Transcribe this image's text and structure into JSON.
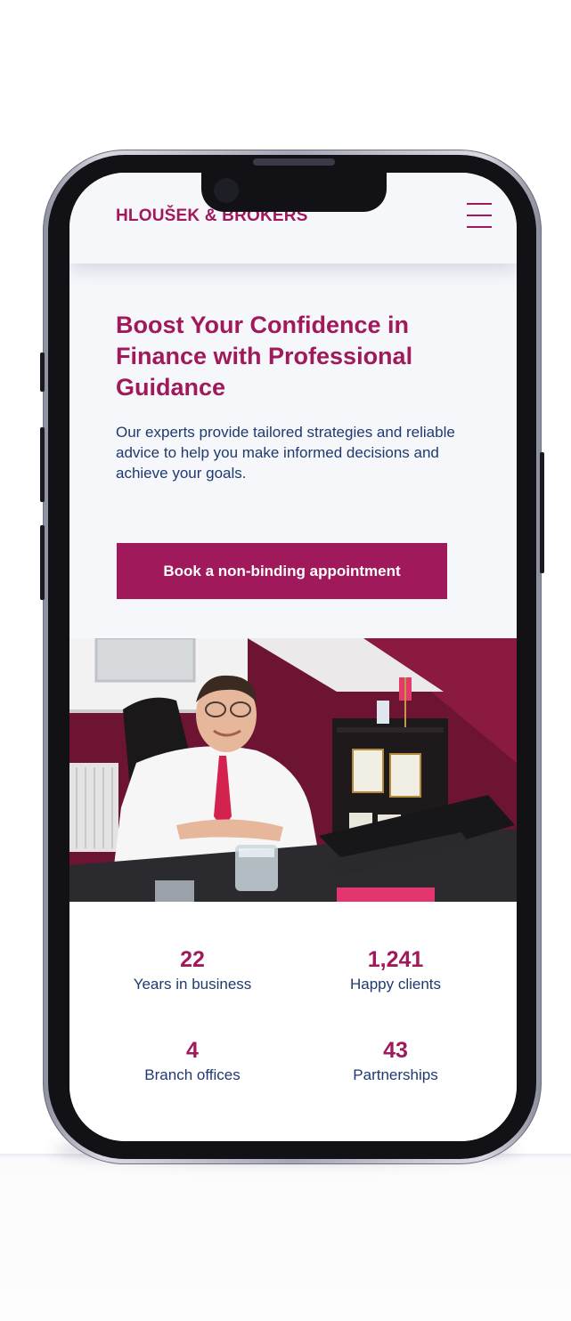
{
  "header": {
    "brand": "HLOUŠEK & BROKERS"
  },
  "hero": {
    "title": "Boost Your Confidence in Finance with Professional Guidance",
    "text": "Our experts provide tailored strategies and reliable advice to help you make informed decisions and achieve your goals.",
    "cta_label": "Book a non-binding appointment"
  },
  "stats": [
    {
      "value": "22",
      "label": "Years in business"
    },
    {
      "value": "1,241",
      "label": "Happy clients"
    },
    {
      "value": "4",
      "label": "Branch offices"
    },
    {
      "value": "43",
      "label": "Partnerships"
    }
  ],
  "icons": {
    "menu": "hamburger-icon"
  },
  "colors": {
    "brand": "#a0195a",
    "body_text": "#1f3a6e",
    "page_background": "#f6f7fb"
  }
}
